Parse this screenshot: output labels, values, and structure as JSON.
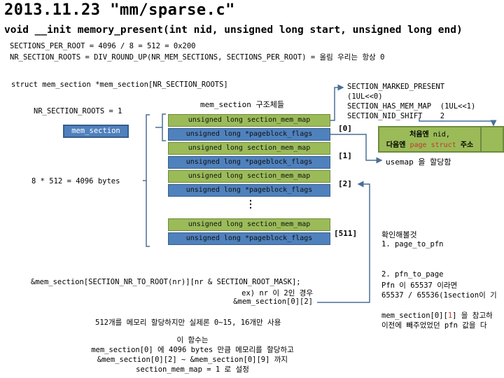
{
  "header": {
    "title": "2013.11.23 \"mm/sparse.c\"",
    "signature": "void __init memory_present(int nid, unsigned long start, unsigned long end)"
  },
  "defines": {
    "sections_per_root": "SECTIONS_PER_ROOT = 4096 / 8 = 512 = 0x200",
    "nr_section_roots": "NR_SECTION_ROOTS = DIV_ROUND_UP(NR_MEM_SECTIONS, SECTIONS_PER_ROOT) = 올림 우리는 항상 0"
  },
  "left": {
    "struct_decl": "struct mem_section *mem_section[NR_SECTION_ROOTS]",
    "nr_roots_value": "NR_SECTION_ROOTS = 1",
    "mem_section_box": "mem_section",
    "size_note": "8 * 512 = 4096 bytes"
  },
  "array": {
    "caption": "mem_section 구조체들",
    "ellipsis": "⋮",
    "entries": [
      {
        "index": "[0]",
        "map": "unsigned long section_mem_map",
        "flags": "unsigned long *pageblock_flags"
      },
      {
        "index": "[1]",
        "map": "unsigned long section_mem_map",
        "flags": "unsigned long *pageblock_flags"
      },
      {
        "index": "[2]",
        "map": "unsigned long section_mem_map",
        "flags": "unsigned long *pageblock_flags"
      },
      {
        "index": "[511]",
        "map": "unsigned long section_mem_map",
        "flags": "unsigned long *pageblock_flags"
      }
    ]
  },
  "flags_info": {
    "lines": [
      "SECTION_MARKED_PRESENT",
      "(1UL<<0)",
      "SECTION_HAS_MEM_MAP  (1UL<<1)",
      "SECTION_NID_SHIFT    2"
    ]
  },
  "section_map_box": {
    "line1_prefix": "처음엔",
    "line1_rest": " nid,",
    "line2_prefix": "다음엔 ",
    "line2_highlight": "page struct",
    "line2_suffix": " 주소"
  },
  "usemap_note": "usemap 을 할당함",
  "todo": {
    "heading": "확인해볼것",
    "item1": "1. page_to_pfn",
    "item2": "2. pfn_to_page",
    "item2_line2": "Pfn 이 65537 이라면",
    "item2_line3": "65537 / 65536(1section이 기",
    "note_line1_prefix": "mem_section[0][",
    "note_line1_highlight": "1",
    "note_line1_suffix": "] 을 참고하",
    "note_line2": "이전에 빼주었었던 pfn 값을 다"
  },
  "bottom": {
    "macro": "&mem_section[SECTION_NR_TO_ROOT(nr)][nr & SECTION_ROOT_MASK];",
    "example": "ex) nr 이 2인 경우",
    "example_result": "&mem_section[0][2]",
    "usage_note": "512개를 메모리 할당하지만 실제론 0~15, 16개만 사용",
    "summary": [
      "이 함수는",
      "mem_section[0] 에 4096 bytes 만큼 메모리를 할당하고",
      "&mem_section[0][2] ~ &mem_section[0][9] 까지",
      "section_mem_map = 1 로 설정"
    ]
  },
  "colors": {
    "green": "#9bbb59",
    "blue": "#4f81bd",
    "connector": "#4a6f95",
    "highlight_red": "#c0392b"
  }
}
